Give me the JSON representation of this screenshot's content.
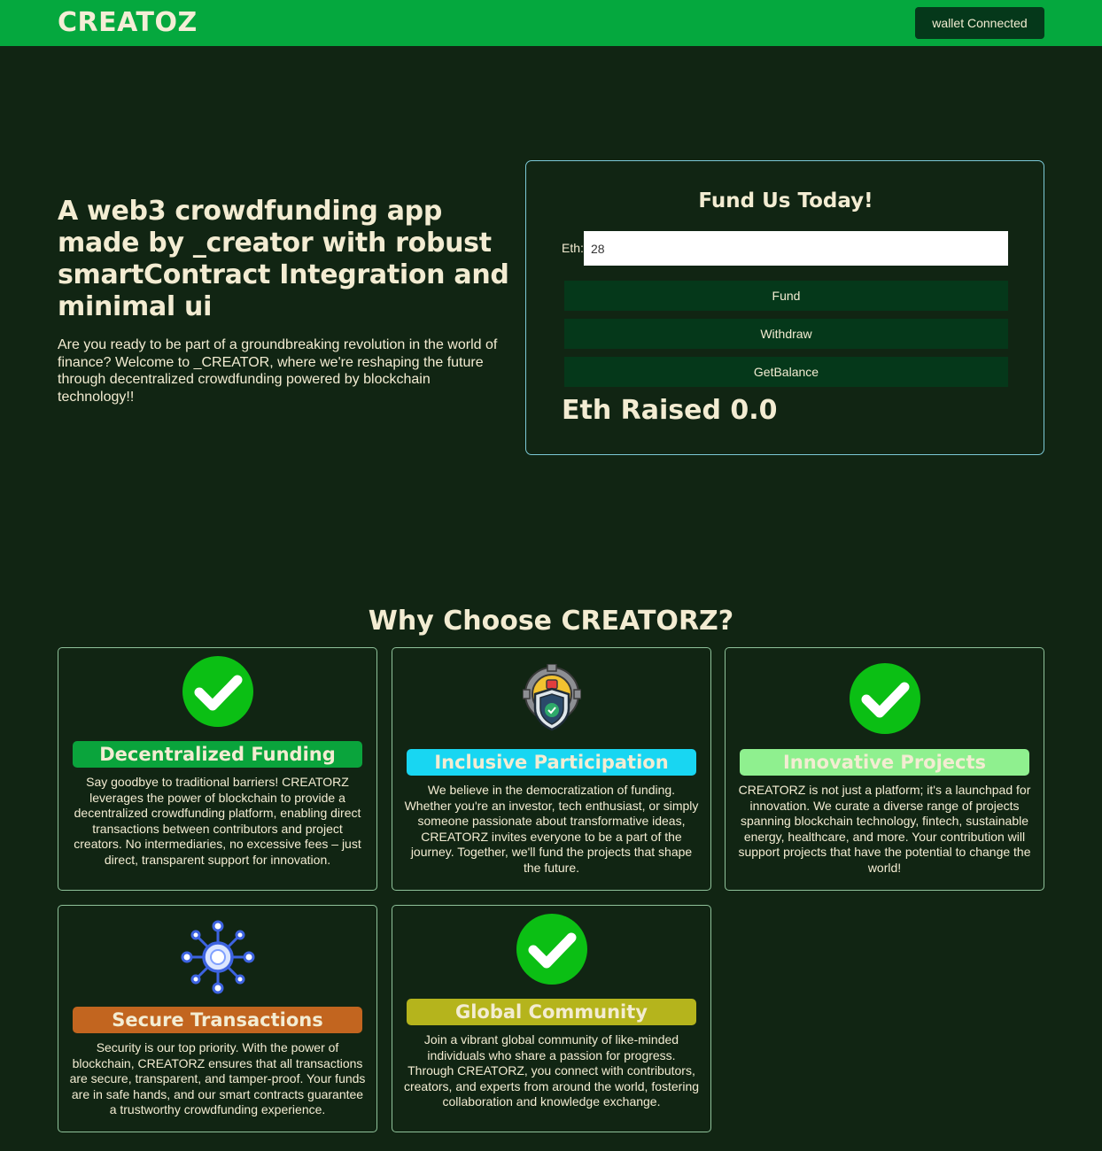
{
  "navbar": {
    "brand": "CREATOZ",
    "wallet_button": "wallet Connected"
  },
  "hero": {
    "title": "A web3 crowdfunding app made by _creator with robust smartContract Integration and minimal ui",
    "description": "Are you ready to be part of a groundbreaking revolution in the world of finance? Welcome to _CREATOR, where we're reshaping the future through decentralized crowdfunding powered by blockchain technology!!"
  },
  "fund_card": {
    "title": "Fund Us Today!",
    "eth_label": "Eth:",
    "eth_value": "28",
    "buttons": {
      "fund": "Fund",
      "withdraw": "Withdraw",
      "get_balance": "GetBalance"
    },
    "raised_label": "Eth Raised",
    "raised_value": "0.0"
  },
  "features": {
    "title": "Why Choose CREATORZ?",
    "items": [
      {
        "icon": "checkmark-icon",
        "label": "Decentralized Funding",
        "color": "#0aa43c",
        "text": "Say goodbye to traditional barriers! CREATORZ leverages the power of blockchain to provide a decentralized crowdfunding platform, enabling direct transactions between contributors and project creators. No intermediaries, no excessive fees – just direct, transparent support for innovation."
      },
      {
        "icon": "security-shield-icon",
        "label": "Inclusive Participation",
        "color": "#18d6f2",
        "text": "We believe in the democratization of funding. Whether you're an investor, tech enthusiast, or simply someone passionate about transformative ideas, CREATORZ invites everyone to be a part of the journey. Together, we'll fund the projects that shape the future."
      },
      {
        "icon": "checkmark-icon",
        "label": "Innovative Projects",
        "color": "#8ff08f",
        "text": "CREATORZ is not just a platform; it's a launchpad for innovation. We curate a diverse range of projects spanning blockchain technology, fintech, sustainable energy, healthcare, and more. Your contribution will support projects that have the potential to change the world!"
      },
      {
        "icon": "network-nodes-icon",
        "label": "Secure Transactions",
        "color": "#c2651f",
        "text": "Security is our top priority. With the power of blockchain, CREATORZ ensures that all transactions are secure, transparent, and tamper-proof. Your funds are in safe hands, and our smart contracts guarantee a trustworthy crowdfunding experience."
      },
      {
        "icon": "checkmark-icon",
        "label": "Global Community",
        "color": "#b5b41c",
        "text": "Join a vibrant global community of like-minded individuals who share a passion for progress. Through CREATORZ, you connect with contributors, creators, and experts from around the world, fostering collaboration and knowledge exchange."
      }
    ]
  }
}
